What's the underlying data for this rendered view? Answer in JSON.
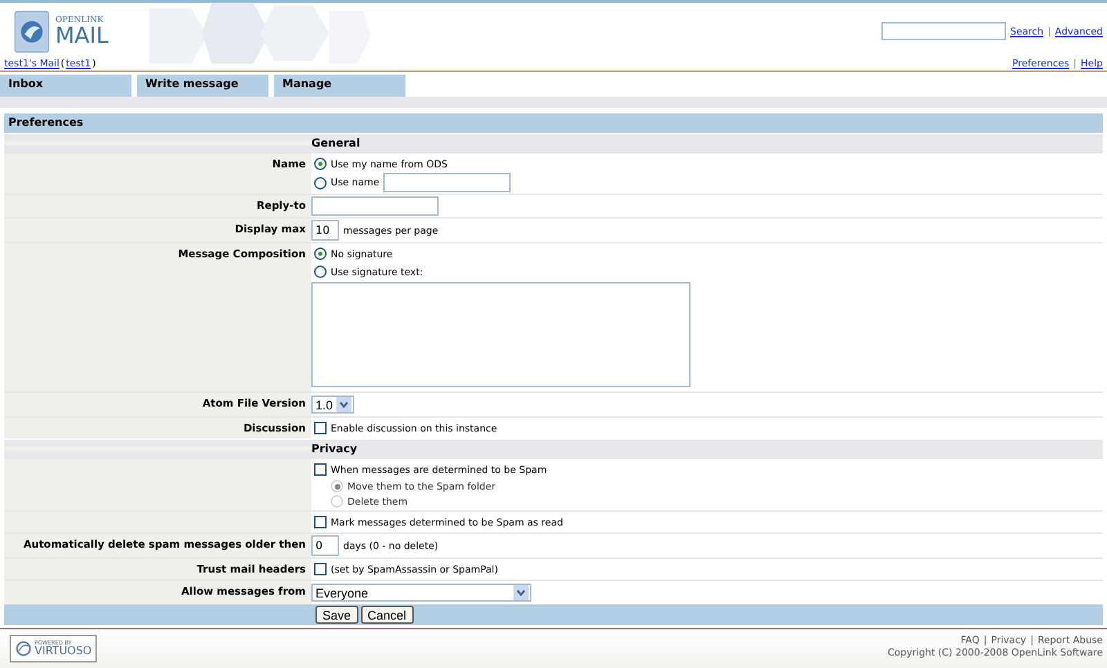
{
  "header": {
    "logo_small": "OPENLINK",
    "logo_big": "MAIL",
    "search_links": [
      "Search",
      "Advanced"
    ],
    "separator": "|"
  },
  "user_bar": {
    "user_link": "test1's Mail",
    "paren_open": "(",
    "account_link": "test1",
    "paren_close": ")",
    "links": [
      "Preferences",
      "Help"
    ],
    "separator": "|"
  },
  "tabs": [
    {
      "label": "Inbox"
    },
    {
      "label": "Write message"
    },
    {
      "label": "Manage"
    }
  ],
  "panel_title": "Preferences",
  "sections": [
    {
      "heading": "General",
      "rows": [
        {
          "label": "Name",
          "lines": [
            [
              {
                "kind": "radio",
                "text": "Use my name from ODS",
                "checked": true
              }
            ],
            [
              {
                "kind": "radio",
                "text": "Use name",
                "checked": false
              },
              {
                "kind": "field"
              }
            ]
          ]
        },
        {
          "label": "Reply-to",
          "lines": [
            [
              {
                "kind": "field"
              }
            ]
          ]
        },
        {
          "label": "Display max",
          "lines": [
            [
              {
                "kind": "short_field",
                "value": "10"
              },
              {
                "kind": "text",
                "text": "messages per page"
              }
            ]
          ]
        },
        {
          "label": "Message Composition",
          "lines": [
            [
              {
                "kind": "radio",
                "text": "No signature",
                "checked": true
              }
            ],
            [
              {
                "kind": "radio",
                "text": "Use signature text:",
                "checked": false
              }
            ],
            [
              {
                "kind": "textarea"
              }
            ]
          ]
        },
        {
          "label": "Atom File Version",
          "lines": [
            [
              {
                "kind": "short_select",
                "value": "1.0"
              }
            ]
          ]
        },
        {
          "label": "Discussion",
          "lines": [
            [
              {
                "kind": "checkbox",
                "text": "Enable discussion on this instance",
                "checked": false
              }
            ]
          ]
        }
      ]
    },
    {
      "heading": "Privacy",
      "rows": [
        {
          "lines": [
            [
              {
                "kind": "checkbox",
                "text": "When messages are determined to be Spam",
                "checked": false,
                "children": [
                  {
                    "kind": "radio",
                    "text": "Move them to the Spam folder",
                    "checked": true,
                    "disabled": true
                  },
                  {
                    "kind": "radio",
                    "text": "Delete them",
                    "checked": false,
                    "disabled": true
                  }
                ]
              }
            ]
          ]
        },
        {
          "lines": [
            [
              {
                "kind": "checkbox",
                "text": "Mark messages determined to be Spam as read",
                "checked": false
              }
            ]
          ]
        },
        {
          "label": "Automatically delete spam messages older then",
          "lines": [
            [
              {
                "kind": "short_field",
                "value": "0"
              },
              {
                "kind": "text",
                "text": "days (0 - no delete)"
              }
            ]
          ]
        },
        {
          "label": "Trust mail headers",
          "lines": [
            [
              {
                "kind": "checkbox",
                "text": "(set by SpamAssassin or SpamPal)",
                "checked": false
              }
            ]
          ]
        },
        {
          "label": "Allow messages from",
          "lines": [
            [
              {
                "kind": "select",
                "value": "Everyone"
              }
            ]
          ]
        }
      ]
    }
  ],
  "buttons": [
    "Save",
    "Cancel"
  ],
  "footer": {
    "badge_small": "POWERED BY",
    "badge_big": "VIRTUOSO",
    "links": [
      "FAQ",
      "Privacy",
      "Report Abuse"
    ],
    "separator": "|",
    "copyright": "Copyright (C) 2000-2008 OpenLink Software"
  }
}
